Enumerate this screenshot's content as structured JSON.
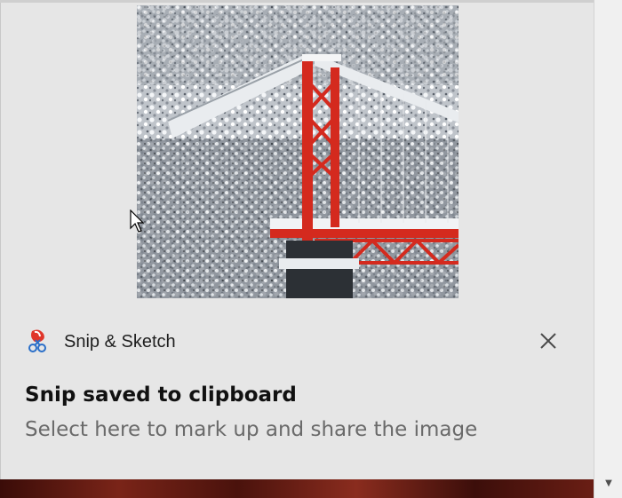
{
  "notification": {
    "app_name": "Snip & Sketch",
    "app_icon": "snip-and-sketch-icon",
    "title": "Snip saved to clipboard",
    "body": "Select here to mark up and share the image",
    "close_icon": "close-icon",
    "preview_description_icon": "screenshot-preview"
  },
  "colors": {
    "toast_background": "#e6e6e6",
    "bridge_red": "#d42a1e",
    "title_text": "#111111",
    "body_text": "#6a6a6a"
  }
}
